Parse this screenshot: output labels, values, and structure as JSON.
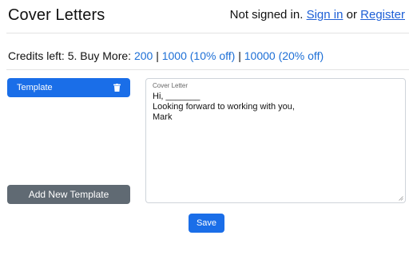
{
  "header": {
    "title": "Cover Letters",
    "auth_status": "Not signed in.",
    "sign_in": "Sign in",
    "or": "or",
    "register": "Register"
  },
  "credits": {
    "prefix": "Credits left: 5. Buy More:",
    "sep": "|",
    "options": [
      "200",
      "1000 (10% off)",
      "10000 (20% off)"
    ]
  },
  "sidebar": {
    "template_label": "Template",
    "add_label": "Add New Template"
  },
  "editor": {
    "label": "Cover Letter",
    "content": "Hi, _______\nLooking forward to working with you,\nMark"
  },
  "actions": {
    "save": "Save"
  },
  "colors": {
    "primary": "#1a6ee8",
    "secondary": "#606a73",
    "link": "#1d5fd6"
  },
  "icons": {
    "delete": "trash-icon",
    "resize": "resize-grip-icon"
  }
}
